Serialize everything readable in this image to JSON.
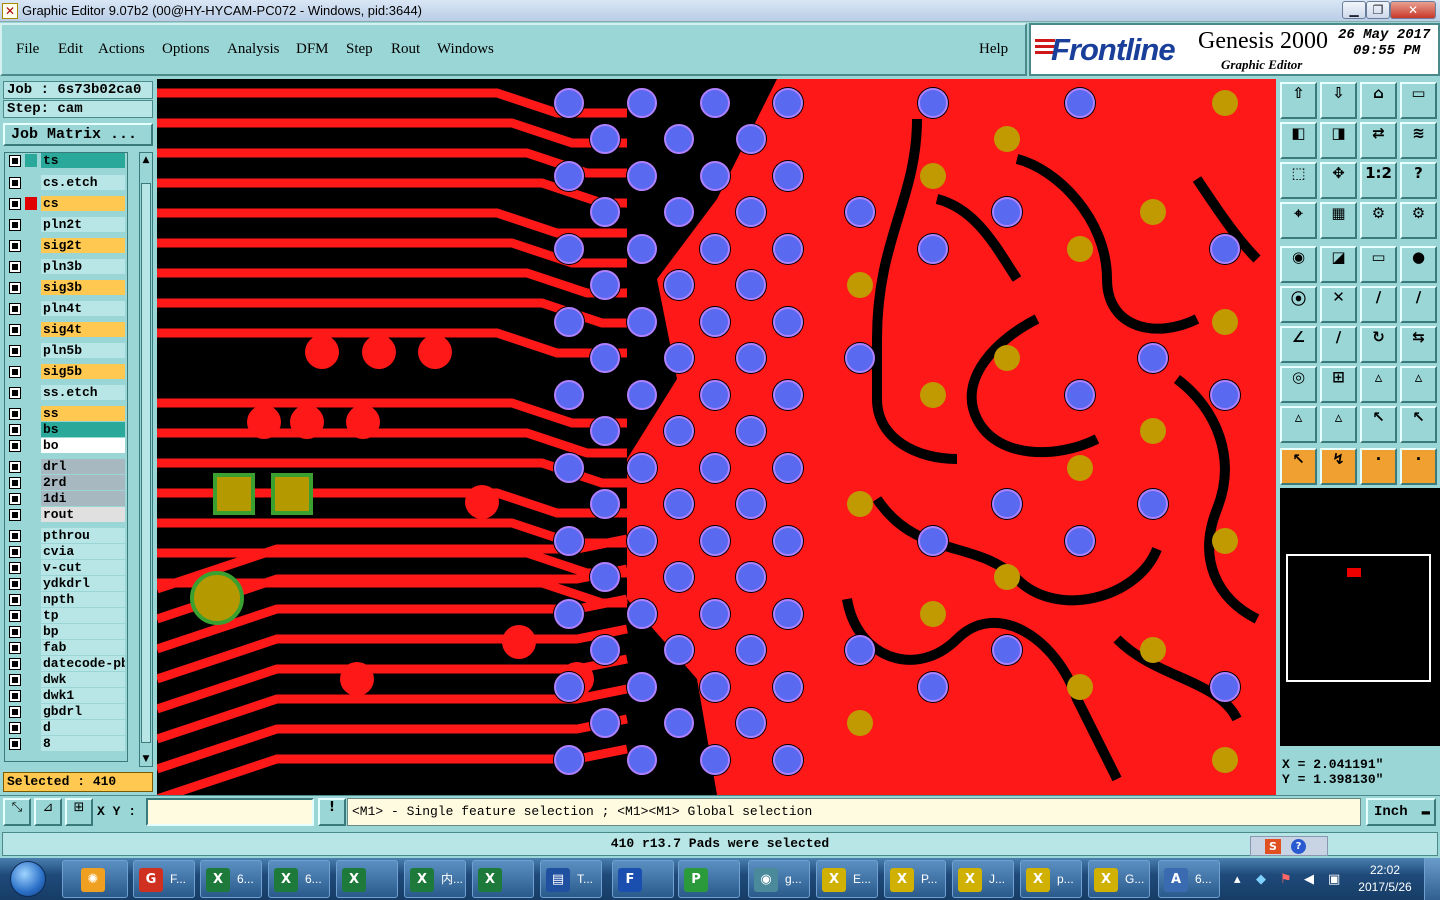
{
  "window": {
    "title": "Graphic Editor 9.07b2 (00@HY-HYCAM-PC072 - Windows, pid:3644)"
  },
  "menu": {
    "file": "File",
    "edit": "Edit",
    "actions": "Actions",
    "options": "Options",
    "analysis": "Analysis",
    "dfm": "DFM",
    "step": "Step",
    "rout": "Rout",
    "windows": "Windows",
    "help": "Help"
  },
  "brand": {
    "logo": "Frontline",
    "product": "Genesis 2000",
    "subtitle": "Graphic Editor",
    "date": "26 May 2017",
    "time": "09:55 PM"
  },
  "job": {
    "job_line": "Job : 6s73b02ca0",
    "step_line": "Step: cam",
    "matrix_button": "Job Matrix ..."
  },
  "layers": [
    {
      "name": "ts",
      "color": "#2aa89a",
      "swatch": "#2aa89a",
      "selected": true
    },
    {
      "name": "cs.etch",
      "color": "#b8e6e6",
      "swatch": "#9ad6d6"
    },
    {
      "name": "cs",
      "color": "#ffc850",
      "swatch": "#e00000"
    },
    {
      "name": "pln2t",
      "color": "#b8e6e6",
      "swatch": "#9ad6d6"
    },
    {
      "name": "sig2t",
      "color": "#ffc850",
      "swatch": "#9ad6d6"
    },
    {
      "name": "pln3b",
      "color": "#b8e6e6",
      "swatch": "#9ad6d6"
    },
    {
      "name": "sig3b",
      "color": "#ffc850",
      "swatch": "#9ad6d6"
    },
    {
      "name": "pln4t",
      "color": "#b8e6e6",
      "swatch": "#9ad6d6"
    },
    {
      "name": "sig4t",
      "color": "#ffc850",
      "swatch": "#9ad6d6"
    },
    {
      "name": "pln5b",
      "color": "#b8e6e6",
      "swatch": "#9ad6d6"
    },
    {
      "name": "sig5b",
      "color": "#ffc850",
      "swatch": "#9ad6d6"
    },
    {
      "name": "ss.etch",
      "color": "#b8e6e6",
      "swatch": "#9ad6d6"
    },
    {
      "name": "ss",
      "color": "#ffc850",
      "swatch": "#9ad6d6"
    },
    {
      "name": "bs",
      "color": "#2aa89a",
      "swatch": "#9ad6d6"
    },
    {
      "name": "bo",
      "color": "#ffffff",
      "swatch": "#9ad6d6"
    },
    {
      "name": "drl",
      "color": "#a8b8c0",
      "swatch": "#9ad6d6"
    },
    {
      "name": "2rd",
      "color": "#a8b8c0",
      "swatch": "#9ad6d6"
    },
    {
      "name": "1di",
      "color": "#a8b8c0",
      "swatch": "#9ad6d6"
    },
    {
      "name": "rout",
      "color": "#e0e0e0",
      "swatch": "#9ad6d6"
    },
    {
      "name": "pthrou",
      "color": "#b8e6e6",
      "swatch": "#9ad6d6"
    },
    {
      "name": "cvia",
      "color": "#b8e6e6",
      "swatch": "#9ad6d6"
    },
    {
      "name": "v-cut",
      "color": "#b8e6e6",
      "swatch": "#9ad6d6"
    },
    {
      "name": "ydkdrl",
      "color": "#b8e6e6",
      "swatch": "#9ad6d6"
    },
    {
      "name": "npth",
      "color": "#b8e6e6",
      "swatch": "#9ad6d6"
    },
    {
      "name": "tp",
      "color": "#b8e6e6",
      "swatch": "#9ad6d6"
    },
    {
      "name": "bp",
      "color": "#b8e6e6",
      "swatch": "#9ad6d6"
    },
    {
      "name": "fab",
      "color": "#b8e6e6",
      "swatch": "#9ad6d6"
    },
    {
      "name": "datecode-pbe",
      "color": "#b8e6e6",
      "swatch": "#9ad6d6"
    },
    {
      "name": "dwk",
      "color": "#b8e6e6",
      "swatch": "#9ad6d6"
    },
    {
      "name": "dwk1",
      "color": "#b8e6e6",
      "swatch": "#9ad6d6"
    },
    {
      "name": "gbdrl",
      "color": "#b8e6e6",
      "swatch": "#9ad6d6"
    },
    {
      "name": "d",
      "color": "#b8e6e6",
      "swatch": "#9ad6d6"
    },
    {
      "name": "8",
      "color": "#b8e6e6",
      "swatch": "#9ad6d6"
    }
  ],
  "selected_text": "Selected : 410",
  "coords": {
    "x": "X = 2.041191\"",
    "y": "Y = 1.398130\""
  },
  "cmd": {
    "xy_label": "X Y :",
    "xy_value": "",
    "hint": "<M1> - Single feature selection ; <M1><M1> Global selection",
    "unit": "Inch",
    "help_mark": "!"
  },
  "status": "410 r13.7 Pads were selected",
  "toolbar_icons": [
    "zoom-home-icon",
    "zoom-in-icon",
    "zoom-window-icon",
    "zoom-out-icon",
    "pan-left-icon",
    "pan-right-icon",
    "swap-icon",
    "filter-icon",
    "fit-icon",
    "center-icon",
    "ratio-icon",
    "query-icon",
    "snap-icon",
    "grid-icon",
    "layer-lock-icon",
    "layer-color-icon",
    "feature-icon",
    "polygon-icon",
    "ruler-icon",
    "pad-icon",
    "node-icon",
    "cross-icon",
    "line-add-icon",
    "arc-add-icon",
    "angle-icon",
    "draw-icon",
    "rotate-icon",
    "mirror-icon",
    "copy-icon",
    "move-icon",
    "stretch-icon",
    "break-icon",
    "dim-icon",
    "measure-icon",
    "pitch-icon",
    "clearance-icon",
    "select-icon",
    "pointer-icon",
    "target-icon",
    "route-icon"
  ],
  "cpanel_icons": [
    "measure-icon",
    "dim-icon",
    "snap-icon",
    "help-icon"
  ],
  "taskbar": {
    "items": [
      {
        "label": "F...",
        "icon": "G",
        "color": "#d03020"
      },
      {
        "label": "6...",
        "icon": "X",
        "color": "#1e7a3a"
      },
      {
        "label": "6...",
        "icon": "X",
        "color": "#1e7a3a"
      },
      {
        "label": "",
        "icon": "X",
        "color": "#1e7a3a"
      },
      {
        "label": "内...",
        "icon": "X",
        "color": "#1e7a3a"
      },
      {
        "label": "",
        "icon": "X",
        "color": "#1e7a3a"
      },
      {
        "label": "T...",
        "icon": "▤",
        "color": "#2050a0"
      },
      {
        "label": "",
        "icon": "F",
        "color": "#1a4fb0"
      },
      {
        "label": "",
        "icon": "P",
        "color": "#2a9a3a"
      },
      {
        "label": "g...",
        "icon": "◉",
        "color": "#4a8a9a"
      },
      {
        "label": "E...",
        "icon": "X",
        "color": "#d0b000"
      },
      {
        "label": "P...",
        "icon": "X",
        "color": "#d0b000"
      },
      {
        "label": "J...",
        "icon": "X",
        "color": "#d0b000"
      },
      {
        "label": "p...",
        "icon": "X",
        "color": "#d0b000"
      },
      {
        "label": "G...",
        "icon": "X",
        "color": "#d0b000"
      },
      {
        "label": "6...",
        "icon": "A",
        "color": "#3a6ab0"
      }
    ],
    "clock_time": "22:02",
    "clock_date": "2017/5/26"
  }
}
